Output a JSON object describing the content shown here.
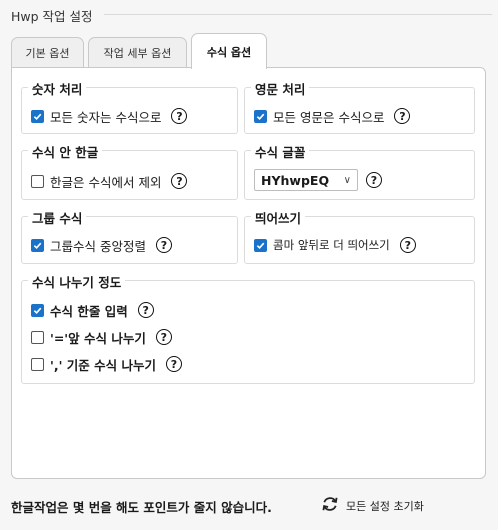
{
  "frame": {
    "title": "Hwp 작업 설정"
  },
  "tabs": [
    {
      "label": "기본 옵션",
      "active": false
    },
    {
      "label": "작업 세부 옵션",
      "active": false
    },
    {
      "label": "수식 옵션",
      "active": true
    }
  ],
  "groups": {
    "number": {
      "title": "숫자 처리",
      "option": {
        "label": "모든 숫자는 수식으로",
        "checked": true
      }
    },
    "english": {
      "title": "영문 처리",
      "option": {
        "label": "모든 영문은 수식으로",
        "checked": true
      }
    },
    "korean": {
      "title": "수식 안 한글",
      "option": {
        "label": "한글은 수식에서 제외",
        "checked": false
      }
    },
    "font": {
      "title": "수식 글꼴",
      "select_value": "HYhwpEQ"
    },
    "group_eq": {
      "title": "그룹 수식",
      "option": {
        "label": "그룹수식 중앙정렬",
        "checked": true
      }
    },
    "spacing": {
      "title": "띄어쓰기",
      "option": {
        "label": "콤마 앞뒤로 더 띄어쓰기",
        "checked": true
      }
    },
    "split": {
      "title": "수식 나누기 정도",
      "options": [
        {
          "label": "수식 한줄 입력",
          "checked": true
        },
        {
          "label": "'='앞 수식 나누기",
          "checked": false
        },
        {
          "label": "',' 기준 수식 나누기",
          "checked": false
        }
      ]
    }
  },
  "help_glyph": "?",
  "select_arrow": "∨",
  "footer": {
    "message": "한글작업은 몇 번을 해도 포인트가 줄지 않습니다.",
    "reset_label": "모든 설정 초기화",
    "reset_icon": "refresh-icon"
  },
  "colors": {
    "accent": "#1a73c8",
    "panel_bg": "#ffffff",
    "window_bg": "#f6f6f6"
  }
}
